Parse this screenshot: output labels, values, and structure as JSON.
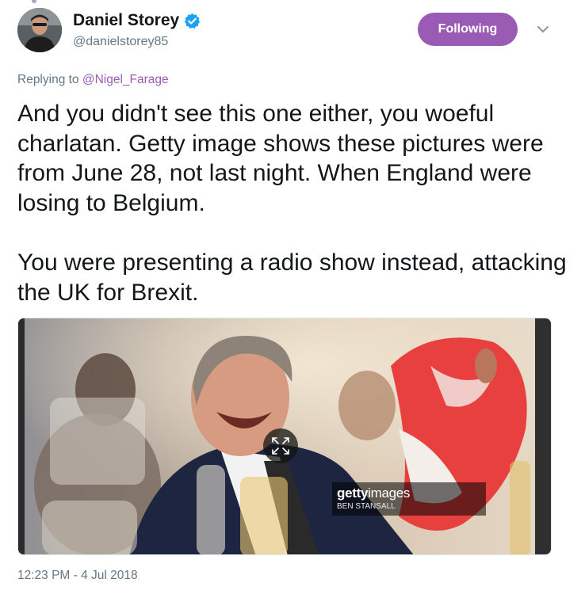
{
  "author": {
    "display_name": "Daniel Storey",
    "handle": "@danielstorey85",
    "verified": true
  },
  "follow_button": {
    "label": "Following",
    "color": "#9a5bb4"
  },
  "menu_icon": "chevron-down-icon",
  "reply": {
    "prefix": "Replying to ",
    "mention": "@Nigel_Farage"
  },
  "tweet": {
    "text": "And you didn't see this one either, you woeful charlatan. Getty image shows these pictures were from June 28, not last night. When England were losing to Belgium.\n\nYou were presenting a radio show instead, attacking the UK for Brexit."
  },
  "media": {
    "watermark_logo_bold": "getty",
    "watermark_logo_rest": "images",
    "watermark_credit": "BEN STANSALL",
    "expand_icon": "expand-icon"
  },
  "timestamp": "12:23 PM - 4 Jul 2018",
  "colors": {
    "link": "#9a5bb4",
    "secondary_text": "#657786",
    "verified": "#1da1f2"
  }
}
